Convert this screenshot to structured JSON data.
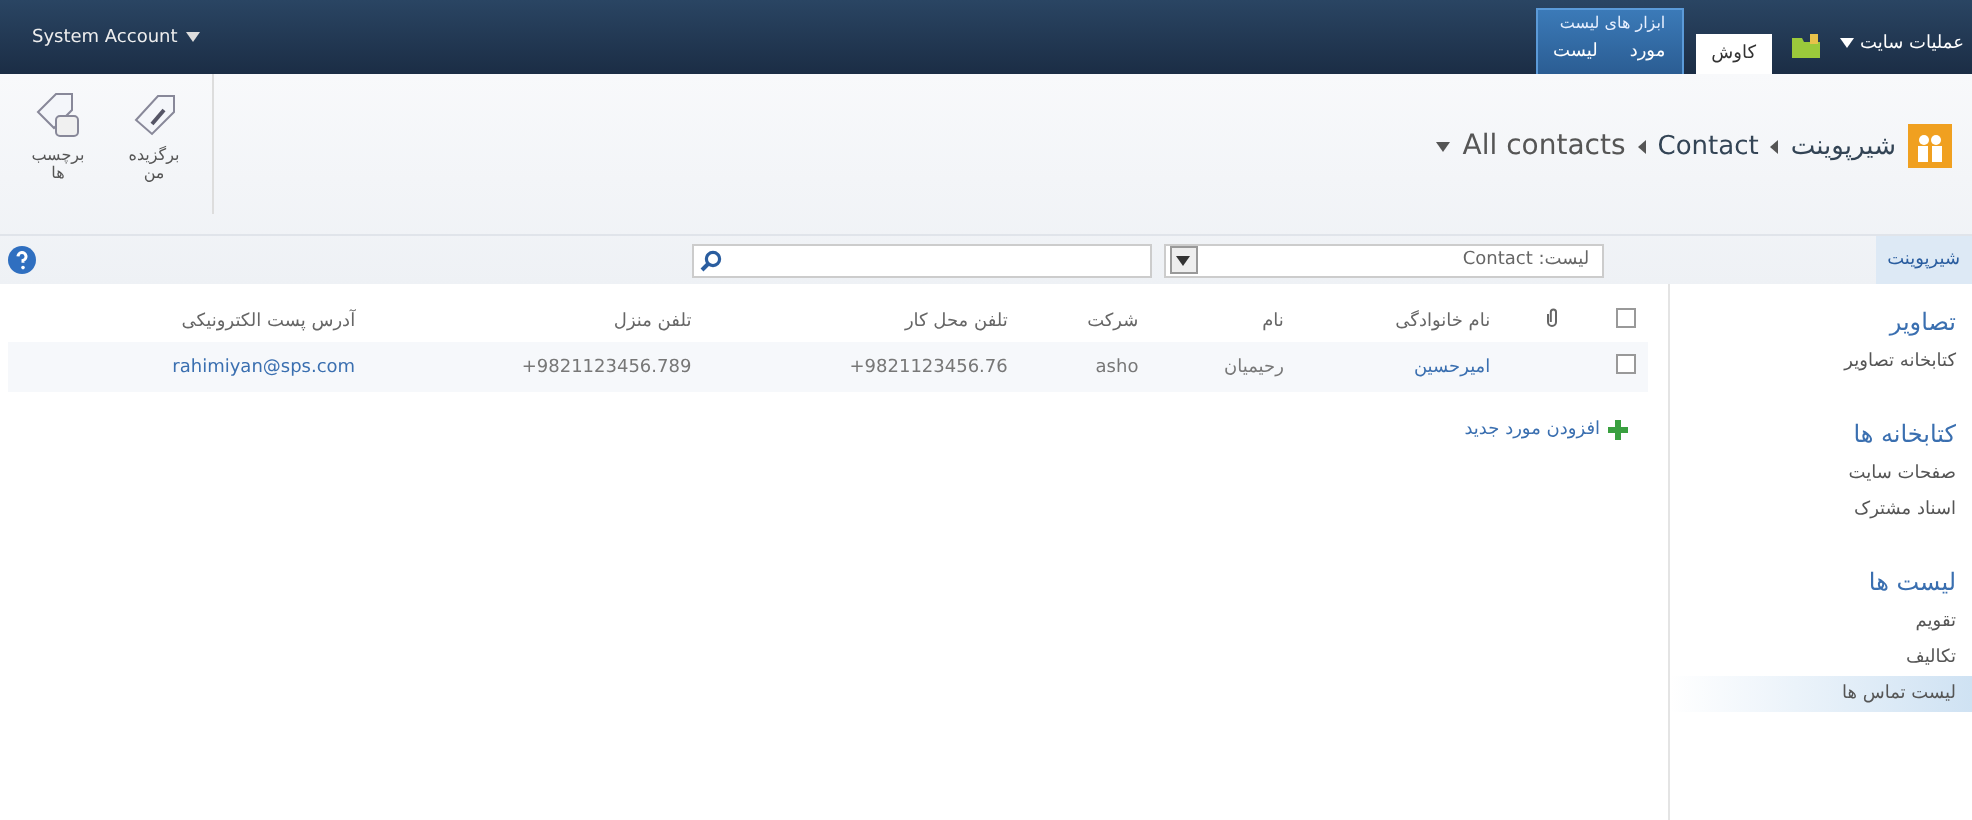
{
  "top_bar": {
    "site_actions": "عملیات سایت",
    "user": "System Account",
    "contextual_group": "ابزار های لیست",
    "tabs": [
      {
        "label": "کاوش",
        "selected": true
      },
      {
        "label": "مورد",
        "selected": false
      },
      {
        "label": "لیست",
        "selected": false
      }
    ]
  },
  "breadcrumb": [
    "شیرپوینت",
    "Contact",
    "All contacts"
  ],
  "ribbon_buttons": [
    {
      "label": "برگزیده من",
      "kind": "tag"
    },
    {
      "label": "برچسب ها",
      "kind": "note"
    }
  ],
  "home_tab": "شیرپوینت",
  "search": {
    "scope": "لیست: Contact"
  },
  "quick_launch": [
    {
      "heading": "تصاویر",
      "items": [
        {
          "label": "کتابخانه تصاویر",
          "selected": false
        }
      ]
    },
    {
      "heading": "کتابخانه ها",
      "items": [
        {
          "label": "صفحات سایت",
          "selected": false
        },
        {
          "label": "اسناد مشترک",
          "selected": false
        }
      ]
    },
    {
      "heading": "لیست ها",
      "items": [
        {
          "label": "تقویم",
          "selected": false
        },
        {
          "label": "تکالیف",
          "selected": false
        },
        {
          "label": "لیست تماس ها",
          "selected": true
        }
      ]
    }
  ],
  "table": {
    "columns": [
      "نام خانوادگی",
      "نام",
      "شرکت",
      "تلفن محل کار",
      "تلفن منزل",
      "آدرس پست الکترونیکی"
    ],
    "select_all_checked": false,
    "rows": [
      {
        "checked": false,
        "cells": [
          "امیرحسین",
          "رحیمیان",
          "asho",
          "9821123456.76+",
          "9821123456.789+",
          "rahimiyan@sps.com"
        ]
      }
    ]
  },
  "add_new": "افزودن مورد جدید"
}
